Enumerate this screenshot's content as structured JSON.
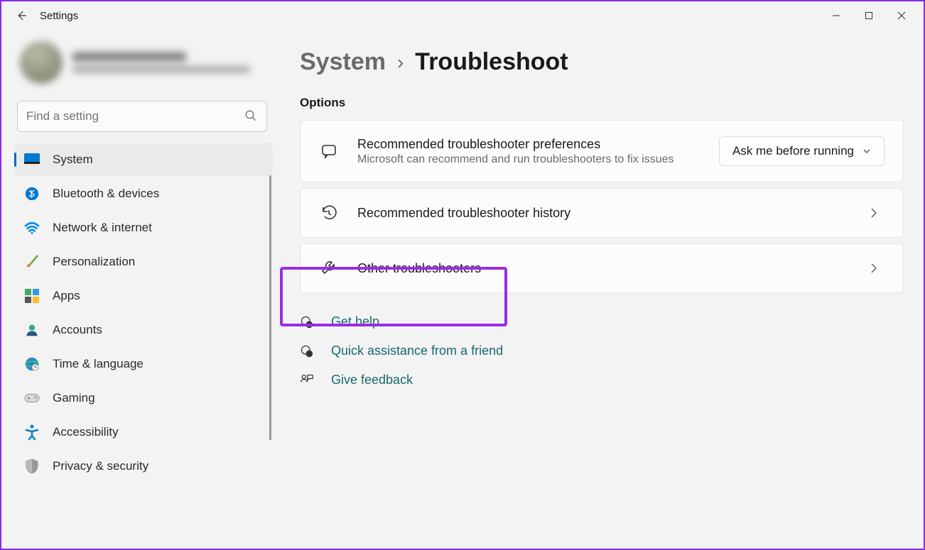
{
  "window": {
    "title": "Settings",
    "min_tooltip": "Minimize",
    "max_tooltip": "Maximize",
    "close_tooltip": "Close"
  },
  "search": {
    "placeholder": "Find a setting"
  },
  "sidebar": {
    "items": [
      {
        "label": "System",
        "icon": "system"
      },
      {
        "label": "Bluetooth & devices",
        "icon": "bluetooth"
      },
      {
        "label": "Network & internet",
        "icon": "wifi"
      },
      {
        "label": "Personalization",
        "icon": "brush"
      },
      {
        "label": "Apps",
        "icon": "apps"
      },
      {
        "label": "Accounts",
        "icon": "person"
      },
      {
        "label": "Time & language",
        "icon": "globe"
      },
      {
        "label": "Gaming",
        "icon": "gamepad"
      },
      {
        "label": "Accessibility",
        "icon": "accessibility"
      },
      {
        "label": "Privacy & security",
        "icon": "shield"
      }
    ]
  },
  "breadcrumb": {
    "parent": "System",
    "current": "Troubleshoot"
  },
  "section": {
    "options": "Options"
  },
  "cards": {
    "prefs": {
      "title": "Recommended troubleshooter preferences",
      "sub": "Microsoft can recommend and run troubleshooters to fix issues",
      "dropdown": "Ask me before running"
    },
    "history": {
      "title": "Recommended troubleshooter history"
    },
    "other": {
      "title": "Other troubleshooters"
    }
  },
  "links": {
    "help": "Get help",
    "assist": "Quick assistance from a friend",
    "feedback": "Give feedback"
  }
}
